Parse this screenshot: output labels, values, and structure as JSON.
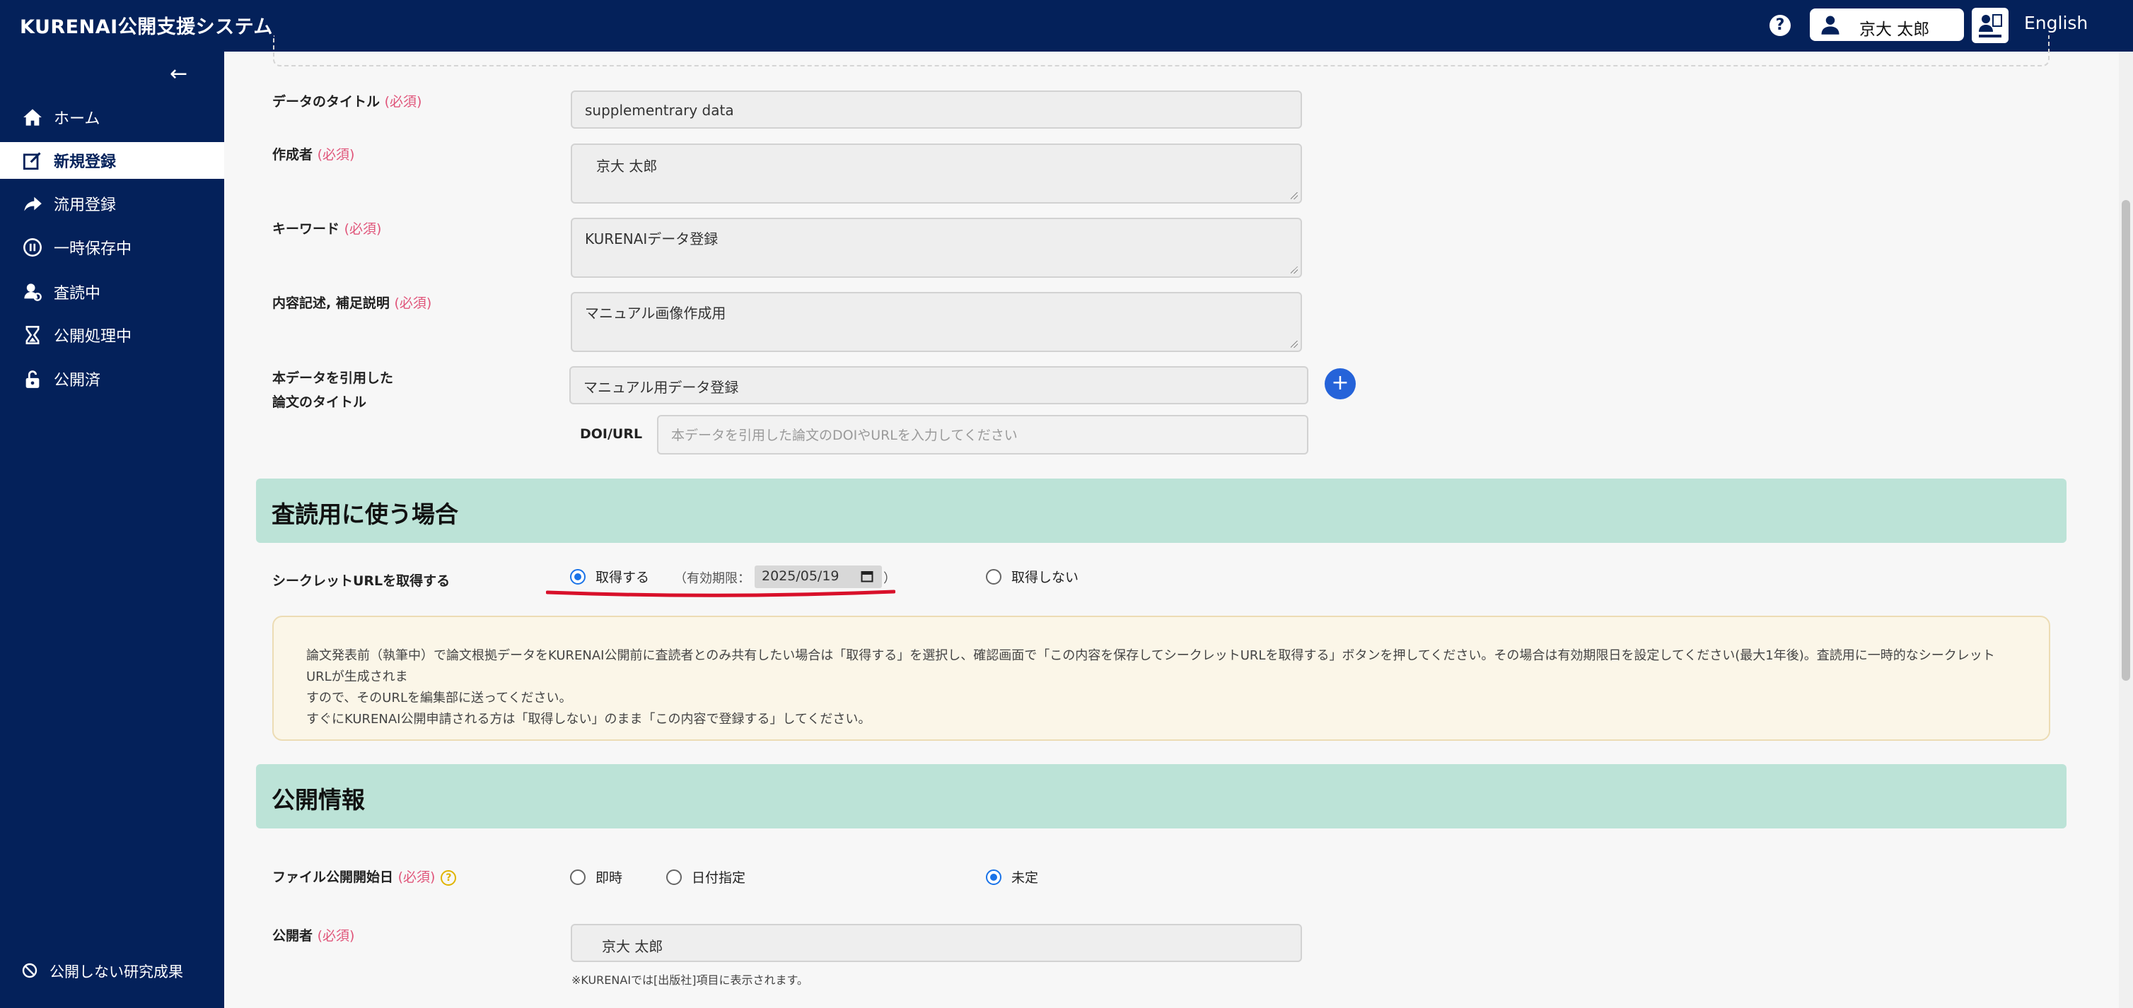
{
  "header": {
    "app_title": "KURENAI公開支援システム",
    "help_label": "?",
    "user_name": "京大 太郎",
    "language": "English"
  },
  "sidebar": {
    "collapse_label": "←",
    "items": [
      {
        "label": "ホーム",
        "icon": "home-icon"
      },
      {
        "label": "新規登録",
        "icon": "edit-icon",
        "active": true
      },
      {
        "label": "流用登録",
        "icon": "share-arrow-icon"
      },
      {
        "label": "一時保存中",
        "icon": "pause-icon"
      },
      {
        "label": "査読中",
        "icon": "review-icon"
      },
      {
        "label": "公開処理中",
        "icon": "hourglass-icon"
      },
      {
        "label": "公開済",
        "icon": "unlock-icon"
      }
    ],
    "bottom_item": {
      "label": "公開しない研究成果",
      "icon": "ban-icon"
    }
  },
  "form": {
    "required_mark": "(必須)",
    "data_title": {
      "label": "データのタイトル",
      "value": "supplementrary data"
    },
    "creator": {
      "label": "作成者",
      "value": "京大 太郎"
    },
    "keyword": {
      "label": "キーワード",
      "value": "KURENAIデータ登録"
    },
    "description": {
      "label": "内容記述, 補足説明",
      "value": "マニュアル画像作成用"
    },
    "paper_title": {
      "label_line1": "本データを引用した",
      "label_line2": "論文のタイトル",
      "value": "マニュアル用データ登録"
    },
    "add_button": "+",
    "doi": {
      "label": "DOI/URL",
      "placeholder": "本データを引用した論文のDOIやURLを入力してください"
    }
  },
  "review_section": {
    "title": "査読用に使う場合",
    "secret_url_label": "シークレットURLを取得する",
    "option_get": "取得する",
    "expiry_prefix": "（有効期限：",
    "expiry_date": "2025/05/19",
    "expiry_suffix": "）",
    "option_not_get": "取得しない",
    "note_line1": "論文発表前（執筆中）で論文根拠データをKURENAI公開前に査読者とのみ共有したい場合は「取得する」を選択し、確認画面で「この内容を保存してシークレットURLを取得する」ボタンを押してください。その場合は有効期限日を設定してください(最大1年後)。査読用に一時的なシークレットURLが生成されま",
    "note_line2": "すので、そのURLを編集部に送ってください。",
    "note_line3": "すぐにKURENAI公開申請される方は「取得しない」のまま「この内容で登録する」してください。"
  },
  "publish_section": {
    "title": "公開情報",
    "start_date_label": "ファイル公開開始日",
    "help_icon": "?",
    "option_immediate": "即時",
    "option_date": "日付指定",
    "option_undecided": "未定",
    "publisher": {
      "label": "公開者",
      "value": "京大 太郎"
    },
    "publisher_note": "※KURENAIでは[出版社]項目に表示されます。"
  },
  "colors": {
    "nav_bg": "#04215a",
    "section_bg": "#bce3d7",
    "required": "#e0557a",
    "accent": "#2563d9",
    "underline": "#d8102a"
  }
}
